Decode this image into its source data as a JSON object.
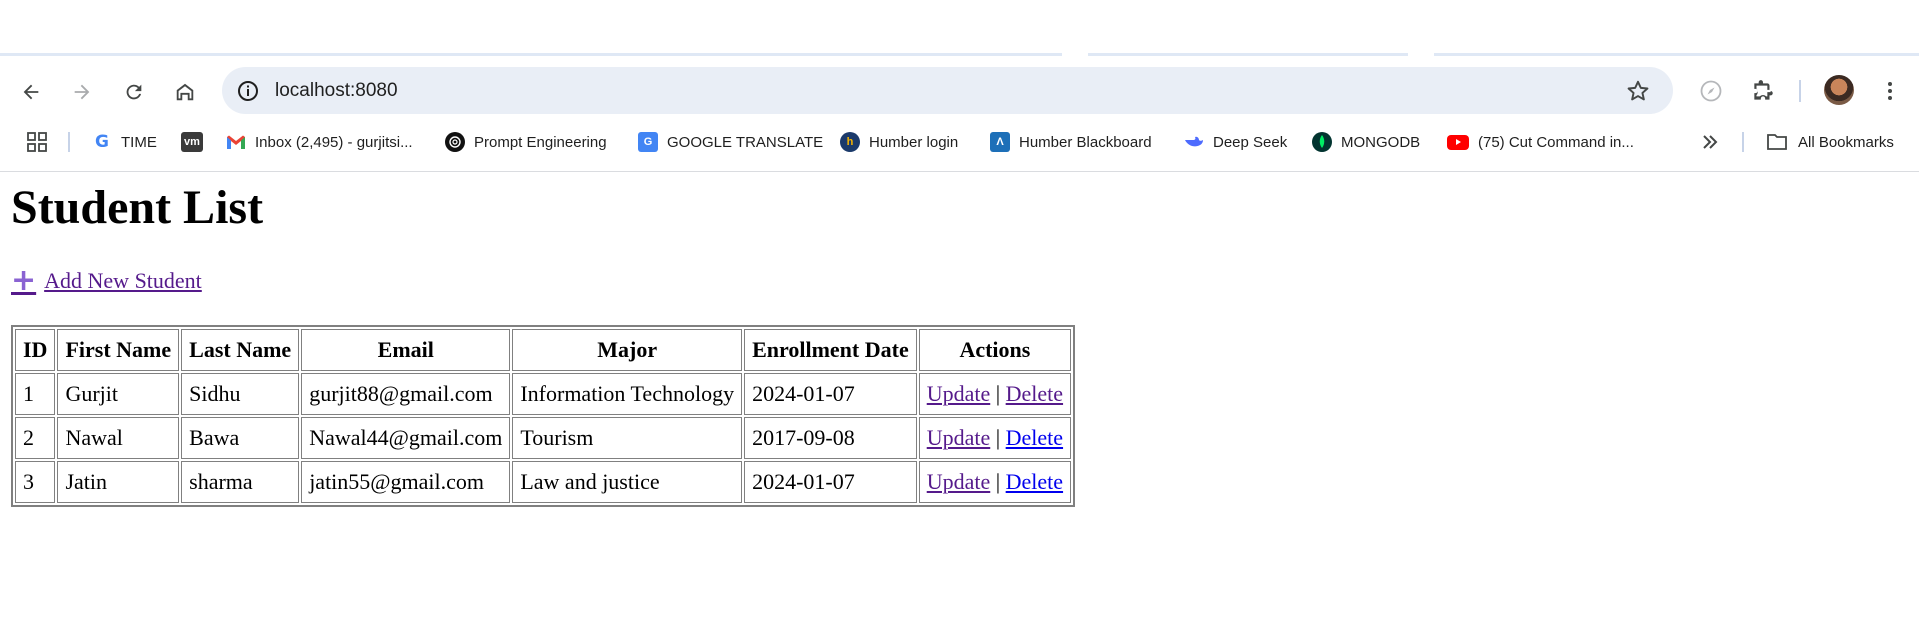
{
  "browser": {
    "url": "localhost:8080",
    "bookmarks": [
      {
        "label": "TIME",
        "icon": "google-icon"
      },
      {
        "label": "",
        "icon": "vm-icon"
      },
      {
        "label": "Inbox (2,495) - gurjitsi...",
        "icon": "gmail-icon"
      },
      {
        "label": "Prompt Engineering",
        "icon": "openai-icon"
      },
      {
        "label": "GOOGLE TRANSLATE",
        "icon": "google-translate-icon"
      },
      {
        "label": "Humber login",
        "icon": "humber-icon"
      },
      {
        "label": "Humber Blackboard",
        "icon": "blackboard-icon"
      },
      {
        "label": "Deep Seek",
        "icon": "deepseek-icon"
      },
      {
        "label": "MONGODB",
        "icon": "mongodb-icon"
      },
      {
        "label": "(75) Cut Command in...",
        "icon": "youtube-icon"
      }
    ],
    "all_bookmarks_label": "All Bookmarks",
    "vm_badge": "vm"
  },
  "page": {
    "title": "Student List",
    "add_link": "Add New Student",
    "table": {
      "headers": [
        "ID",
        "First Name",
        "Last Name",
        "Email",
        "Major",
        "Enrollment Date",
        "Actions"
      ],
      "rows": [
        {
          "id": "1",
          "first": "Gurjit",
          "last": "Sidhu",
          "email": "gurjit88@gmail.com",
          "major": "Information Technology",
          "date": "2024-01-07"
        },
        {
          "id": "2",
          "first": "Nawal",
          "last": "Bawa",
          "email": "Nawal44@gmail.com",
          "major": "Tourism",
          "date": "2017-09-08"
        },
        {
          "id": "3",
          "first": "Jatin",
          "last": "sharma",
          "email": "jatin55@gmail.com",
          "major": "Law and justice",
          "date": "2024-01-07"
        }
      ],
      "update_label": "Update",
      "delete_label": "Delete",
      "separator": "|"
    }
  },
  "colors": {
    "visited_link": "#551a8b",
    "unvisited_link": "#0000ee",
    "omnibox_bg": "#e9eef6"
  }
}
